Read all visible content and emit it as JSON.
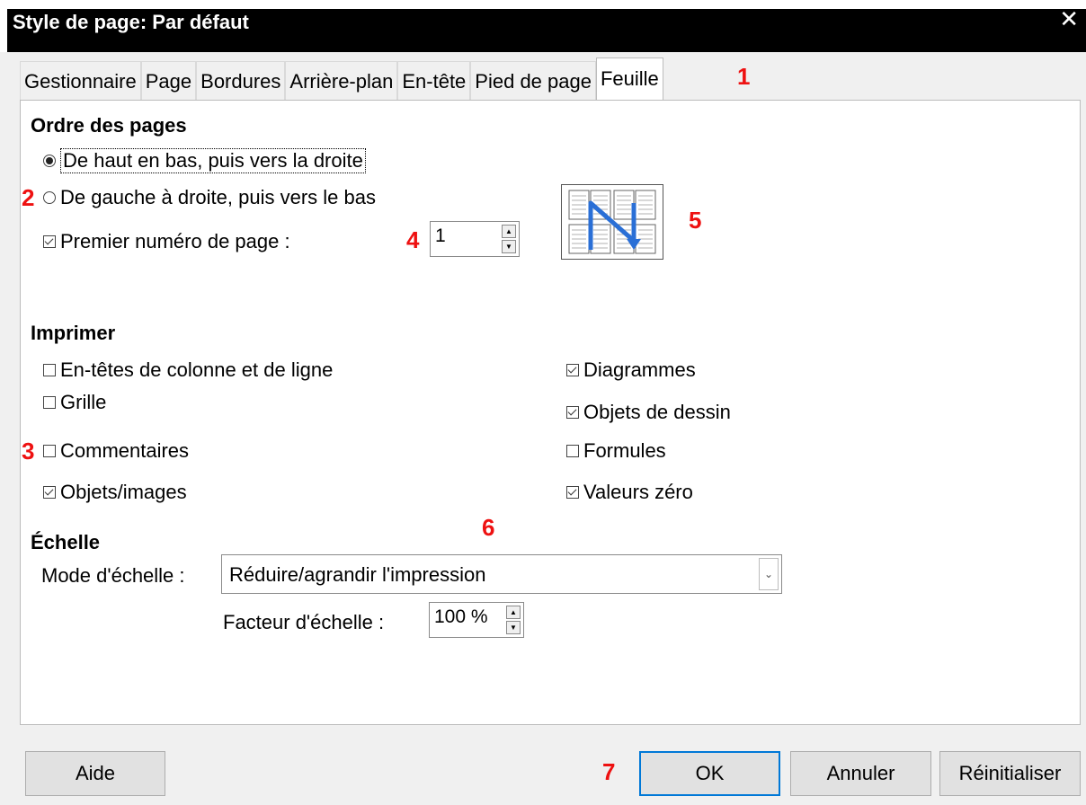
{
  "window": {
    "title": "Style de page: Par défaut",
    "close_glyph": "✕"
  },
  "tabs": [
    {
      "label": "Gestionnaire"
    },
    {
      "label": "Page"
    },
    {
      "label": "Bordures"
    },
    {
      "label": "Arrière-plan"
    },
    {
      "label": "En-tête"
    },
    {
      "label": "Pied de page"
    },
    {
      "label": "Feuille",
      "active": true
    }
  ],
  "page_order": {
    "heading": "Ordre des pages",
    "top_then_right": {
      "label": "De haut en bas, puis vers la droite",
      "selected": true
    },
    "left_then_down": {
      "label": "De gauche à droite, puis vers le bas",
      "selected": false
    },
    "first_page_number": {
      "label": "Premier numéro de page :",
      "checked": true,
      "value": "1"
    },
    "preview_icon": "page-order-top-down-icon"
  },
  "print": {
    "heading": "Imprimer",
    "items": [
      {
        "label": "En-têtes de colonne et de ligne",
        "checked": false
      },
      {
        "label": "Grille",
        "checked": false
      },
      {
        "label": "Commentaires",
        "checked": false
      },
      {
        "label": "Objets/images",
        "checked": true
      },
      {
        "label": "Diagrammes",
        "checked": true
      },
      {
        "label": "Objets de dessin",
        "checked": true
      },
      {
        "label": "Formules",
        "checked": false
      },
      {
        "label": "Valeurs zéro",
        "checked": true
      }
    ]
  },
  "scale": {
    "heading": "Échelle",
    "mode_label": "Mode d'échelle :",
    "mode_value": "Réduire/agrandir l'impression",
    "factor_label": "Facteur d'échelle :",
    "factor_value": "100 %"
  },
  "markers": [
    "1",
    "2",
    "3",
    "4",
    "5",
    "6",
    "7"
  ],
  "marker_color": "#ee1111",
  "buttons": {
    "help": "Aide",
    "ok": "OK",
    "cancel": "Annuler",
    "reset": "Réinitialiser"
  }
}
